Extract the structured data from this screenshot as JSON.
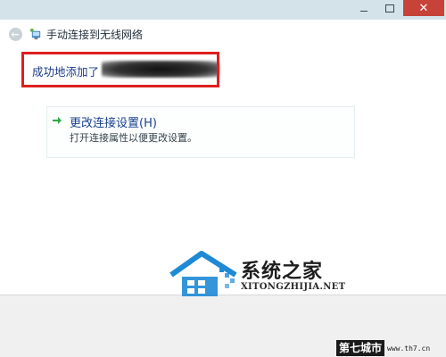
{
  "window": {
    "title_buttons": {
      "close_glyph": "✕"
    },
    "nav": {
      "title": "手动连接到无线网络",
      "back_glyph": "←"
    }
  },
  "main": {
    "success_text": "成功地添加了",
    "options": [
      {
        "label": "更改连接设置(H)",
        "description": "打开连接属性以便更改设置。"
      }
    ]
  },
  "watermark": {
    "title": "系统之家",
    "url": "XITONGZHIJIA.NET"
  },
  "corner_tag": {
    "label": "第七城市",
    "url": "www.th7.cn"
  },
  "colors": {
    "accent_red": "#df1f1f",
    "link_blue": "#16408f",
    "arrow_green": "#2aa84a",
    "watermark_blue": "#1e8ad6"
  },
  "icons": [
    "wifi-icon",
    "back-icon",
    "arrow-right-icon",
    "watermark-house-logo"
  ]
}
